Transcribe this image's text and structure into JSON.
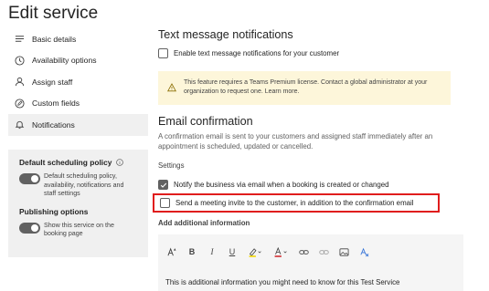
{
  "page": {
    "title": "Edit service"
  },
  "nav": {
    "items": [
      {
        "label": "Basic details",
        "icon": "list-icon"
      },
      {
        "label": "Availability options",
        "icon": "clock-icon"
      },
      {
        "label": "Assign staff",
        "icon": "person-icon"
      },
      {
        "label": "Custom fields",
        "icon": "edit-circle-icon"
      },
      {
        "label": "Notifications",
        "icon": "bell-icon"
      }
    ]
  },
  "policy_panel": {
    "title": "Default scheduling policy",
    "toggle_text": "Default scheduling policy, availability, notifications and staff settings",
    "publishing_title": "Publishing options",
    "publishing_toggle_text": "Show this service on the booking page"
  },
  "text_notifications": {
    "heading": "Text message notifications",
    "checkbox_label": "Enable text message notifications for your customer",
    "warning": "This feature requires a Teams Premium license. Contact a global administrator at your organization to request one. Learn more."
  },
  "email_confirmation": {
    "heading": "Email confirmation",
    "description": "A confirmation email is sent to your customers and assigned staff immediately after an appointment is scheduled, updated or cancelled.",
    "settings_label": "Settings",
    "notify_label": "Notify the business via email when a booking is created or changed",
    "invite_label": "Send a meeting invite to the customer, in addition to the confirmation email",
    "additional_label": "Add additional information",
    "editor_text": "This is additional information you might need to know for this Test Service"
  },
  "colors": {
    "highlight_border": "#e01d1d",
    "warning_bg": "#fdf6da",
    "toggle_on": "#616161"
  }
}
